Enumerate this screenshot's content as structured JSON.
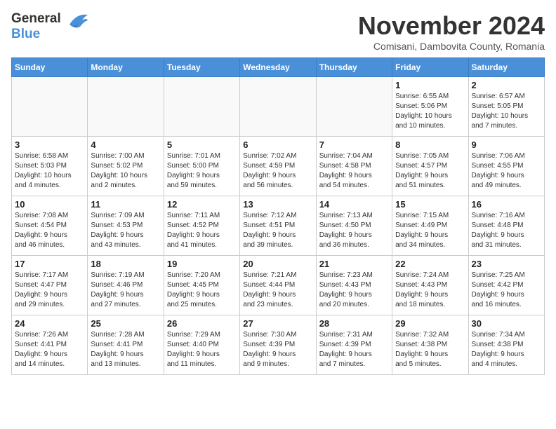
{
  "header": {
    "logo_line1": "General",
    "logo_line2": "Blue",
    "month_title": "November 2024",
    "location": "Comisani, Dambovita County, Romania"
  },
  "weekdays": [
    "Sunday",
    "Monday",
    "Tuesday",
    "Wednesday",
    "Thursday",
    "Friday",
    "Saturday"
  ],
  "weeks": [
    [
      {
        "day": "",
        "info": ""
      },
      {
        "day": "",
        "info": ""
      },
      {
        "day": "",
        "info": ""
      },
      {
        "day": "",
        "info": ""
      },
      {
        "day": "",
        "info": ""
      },
      {
        "day": "1",
        "info": "Sunrise: 6:55 AM\nSunset: 5:06 PM\nDaylight: 10 hours\nand 10 minutes."
      },
      {
        "day": "2",
        "info": "Sunrise: 6:57 AM\nSunset: 5:05 PM\nDaylight: 10 hours\nand 7 minutes."
      }
    ],
    [
      {
        "day": "3",
        "info": "Sunrise: 6:58 AM\nSunset: 5:03 PM\nDaylight: 10 hours\nand 4 minutes."
      },
      {
        "day": "4",
        "info": "Sunrise: 7:00 AM\nSunset: 5:02 PM\nDaylight: 10 hours\nand 2 minutes."
      },
      {
        "day": "5",
        "info": "Sunrise: 7:01 AM\nSunset: 5:00 PM\nDaylight: 9 hours\nand 59 minutes."
      },
      {
        "day": "6",
        "info": "Sunrise: 7:02 AM\nSunset: 4:59 PM\nDaylight: 9 hours\nand 56 minutes."
      },
      {
        "day": "7",
        "info": "Sunrise: 7:04 AM\nSunset: 4:58 PM\nDaylight: 9 hours\nand 54 minutes."
      },
      {
        "day": "8",
        "info": "Sunrise: 7:05 AM\nSunset: 4:57 PM\nDaylight: 9 hours\nand 51 minutes."
      },
      {
        "day": "9",
        "info": "Sunrise: 7:06 AM\nSunset: 4:55 PM\nDaylight: 9 hours\nand 49 minutes."
      }
    ],
    [
      {
        "day": "10",
        "info": "Sunrise: 7:08 AM\nSunset: 4:54 PM\nDaylight: 9 hours\nand 46 minutes."
      },
      {
        "day": "11",
        "info": "Sunrise: 7:09 AM\nSunset: 4:53 PM\nDaylight: 9 hours\nand 43 minutes."
      },
      {
        "day": "12",
        "info": "Sunrise: 7:11 AM\nSunset: 4:52 PM\nDaylight: 9 hours\nand 41 minutes."
      },
      {
        "day": "13",
        "info": "Sunrise: 7:12 AM\nSunset: 4:51 PM\nDaylight: 9 hours\nand 39 minutes."
      },
      {
        "day": "14",
        "info": "Sunrise: 7:13 AM\nSunset: 4:50 PM\nDaylight: 9 hours\nand 36 minutes."
      },
      {
        "day": "15",
        "info": "Sunrise: 7:15 AM\nSunset: 4:49 PM\nDaylight: 9 hours\nand 34 minutes."
      },
      {
        "day": "16",
        "info": "Sunrise: 7:16 AM\nSunset: 4:48 PM\nDaylight: 9 hours\nand 31 minutes."
      }
    ],
    [
      {
        "day": "17",
        "info": "Sunrise: 7:17 AM\nSunset: 4:47 PM\nDaylight: 9 hours\nand 29 minutes."
      },
      {
        "day": "18",
        "info": "Sunrise: 7:19 AM\nSunset: 4:46 PM\nDaylight: 9 hours\nand 27 minutes."
      },
      {
        "day": "19",
        "info": "Sunrise: 7:20 AM\nSunset: 4:45 PM\nDaylight: 9 hours\nand 25 minutes."
      },
      {
        "day": "20",
        "info": "Sunrise: 7:21 AM\nSunset: 4:44 PM\nDaylight: 9 hours\nand 23 minutes."
      },
      {
        "day": "21",
        "info": "Sunrise: 7:23 AM\nSunset: 4:43 PM\nDaylight: 9 hours\nand 20 minutes."
      },
      {
        "day": "22",
        "info": "Sunrise: 7:24 AM\nSunset: 4:43 PM\nDaylight: 9 hours\nand 18 minutes."
      },
      {
        "day": "23",
        "info": "Sunrise: 7:25 AM\nSunset: 4:42 PM\nDaylight: 9 hours\nand 16 minutes."
      }
    ],
    [
      {
        "day": "24",
        "info": "Sunrise: 7:26 AM\nSunset: 4:41 PM\nDaylight: 9 hours\nand 14 minutes."
      },
      {
        "day": "25",
        "info": "Sunrise: 7:28 AM\nSunset: 4:41 PM\nDaylight: 9 hours\nand 13 minutes."
      },
      {
        "day": "26",
        "info": "Sunrise: 7:29 AM\nSunset: 4:40 PM\nDaylight: 9 hours\nand 11 minutes."
      },
      {
        "day": "27",
        "info": "Sunrise: 7:30 AM\nSunset: 4:39 PM\nDaylight: 9 hours\nand 9 minutes."
      },
      {
        "day": "28",
        "info": "Sunrise: 7:31 AM\nSunset: 4:39 PM\nDaylight: 9 hours\nand 7 minutes."
      },
      {
        "day": "29",
        "info": "Sunrise: 7:32 AM\nSunset: 4:38 PM\nDaylight: 9 hours\nand 5 minutes."
      },
      {
        "day": "30",
        "info": "Sunrise: 7:34 AM\nSunset: 4:38 PM\nDaylight: 9 hours\nand 4 minutes."
      }
    ]
  ]
}
